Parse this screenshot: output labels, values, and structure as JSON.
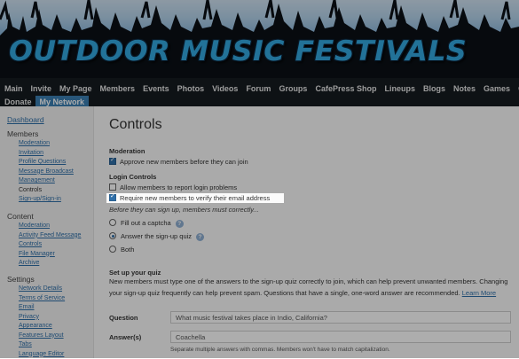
{
  "site": {
    "title": "OUTDOOR MUSIC FESTIVALS"
  },
  "nav": {
    "row1": [
      "Main",
      "Invite",
      "My Page",
      "Members",
      "Events",
      "Photos",
      "Videos",
      "Forum",
      "Groups",
      "CafePress Shop",
      "Lineups",
      "Blogs",
      "Notes",
      "Games",
      "Chat"
    ],
    "row2": [
      "Donate",
      "My Network"
    ],
    "active": "My Network"
  },
  "sidebar": {
    "dashboard": "Dashboard",
    "members_head": "Members",
    "members": [
      "Moderation",
      "Invitation",
      "Profile Questions",
      "Message Broadcast",
      "Management",
      "Controls",
      "Sign-up/Sign-in"
    ],
    "content_head": "Content",
    "content": [
      "Moderation",
      "Activity Feed Message",
      "Controls",
      "File Manager",
      "Archive"
    ],
    "settings_head": "Settings",
    "settings": [
      "Network Details",
      "Terms of Service",
      "Email",
      "Privacy",
      "Appearance",
      "Features Layout",
      "Tabs",
      "Language Editor"
    ]
  },
  "main": {
    "title": "Controls",
    "moderation_title": "Moderation",
    "approve_label": "Approve new members before they can join",
    "login_title": "Login Controls",
    "report_label": "Allow members to report login problems",
    "verify_label": "Require new members to verify their email address",
    "before_note": "Before they can sign up, members must correctly...",
    "radio_captcha": "Fill out a captcha",
    "radio_quiz": "Answer the sign-up quiz",
    "radio_both": "Both",
    "help_glyph": "?",
    "quiz_title": "Set up your quiz",
    "quiz_para": "New members must type one of the answers to the sign-up quiz correctly to join, which can help prevent unwanted members. Changing your sign-up quiz frequently can help prevent spam. Questions that have a single, one-word answer are recommended.",
    "learn_more": "Learn More",
    "question_label": "Question",
    "question_value": "What music festival takes place in Indio, California?",
    "answers_label": "Answer(s)",
    "answers_value": "Coachella",
    "answers_hint": "Separate multiple answers with commas. Members won't have to match capitalization."
  }
}
